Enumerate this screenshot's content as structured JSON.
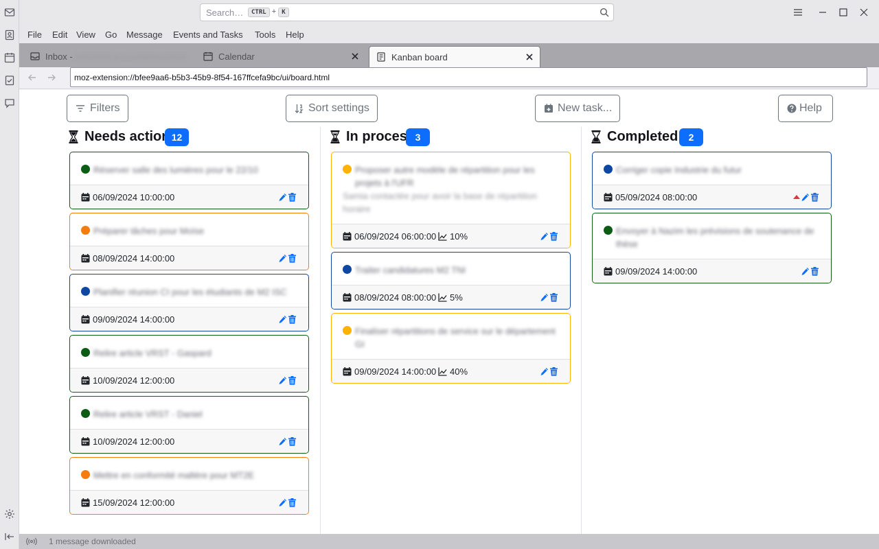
{
  "window": {
    "search_placeholder": "Search…",
    "search_key1": "CTRL",
    "search_plus": "+",
    "search_key2": "K"
  },
  "menubar": [
    "File",
    "Edit",
    "View",
    "Go",
    "Message",
    "Events and Tasks",
    "Tools",
    "Help"
  ],
  "tabs": [
    {
      "label": "Inbox - ",
      "label_blurred": "redacted-account@example",
      "icon": "inbox-icon",
      "active": false
    },
    {
      "label": "Calendar",
      "icon": "calendar-icon",
      "active": false
    },
    {
      "label": "Kanban board",
      "icon": "kanban-icon",
      "active": true
    }
  ],
  "address": {
    "url": "moz-extension://bfee9aa6-b5b3-45b9-8f54-167ffcefa9bc/ui/board.html"
  },
  "toolbar": {
    "filters": "Filters",
    "sort": "Sort settings",
    "new_task": "New task...",
    "help": "Help"
  },
  "columns": [
    {
      "title": "Needs action",
      "count": "12",
      "cards": [
        {
          "title": "Réserver salle des lumières pour le 22/10",
          "dot": "#0b5c14",
          "border": "#0b5c14",
          "date": "06/09/2024 10:00:00"
        },
        {
          "title": "Préparer tâches pour Moïse",
          "dot": "#f57c0e",
          "border": "#f57c0e",
          "date": "08/09/2024 14:00:00"
        },
        {
          "title": "Planifier réunion CI pour les étudiants de M2 ISC",
          "dot": "#0d47a1",
          "border": "#0d47a1",
          "date": "09/09/2024 14:00:00"
        },
        {
          "title": "Relire article VRST - Gaspard",
          "dot": "#0b5c14",
          "border": "#0b5c14",
          "date": "10/09/2024 12:00:00"
        },
        {
          "title": "Relire article VRST - Daniel",
          "dot": "#0b5c14",
          "border": "#0b5c14",
          "date": "10/09/2024 12:00:00"
        },
        {
          "title": "Mettre en conformité maltère pour MT2E",
          "dot": "#f57c0e",
          "border": "#f57c0e",
          "date": "15/09/2024 12:00:00"
        }
      ]
    },
    {
      "title": "In process",
      "count": "3",
      "cards": [
        {
          "title": "Proposer autre modèle de répartition pour les projets à l'UFR",
          "desc": "Samia contactée pour avoir la base de répartition horaire",
          "dot": "#ffb300",
          "border": "#ffb300",
          "date": "06/09/2024 06:00:00",
          "progress": "10%"
        },
        {
          "title": "Traiter candidatures M2 TNI",
          "dot": "#0d47a1",
          "border": "#0d47a1",
          "date": "08/09/2024 08:00:00",
          "progress": "5%"
        },
        {
          "title": "Finaliser répartitions de service sur le département GI",
          "dot": "#ffb300",
          "border": "#ffb300",
          "date": "09/09/2024 14:00:00",
          "progress": "40%"
        }
      ]
    },
    {
      "title": "Completed",
      "count": "2",
      "cards": [
        {
          "title": "Corriger copie Industrie du futur",
          "dot": "#0d47a1",
          "border": "#0d47a1",
          "date": "05/09/2024 08:00:00",
          "priority_high": true
        },
        {
          "title": "Envoyer à Nazim les prévisions de soutenance de thèse",
          "dot": "#0b5c14",
          "border": "#0b5c14",
          "date": "09/09/2024 14:00:00"
        }
      ]
    }
  ],
  "status": {
    "text": "1 message downloaded"
  },
  "colors": {
    "accent": "#0d6efd",
    "priority": "#dc3545"
  }
}
